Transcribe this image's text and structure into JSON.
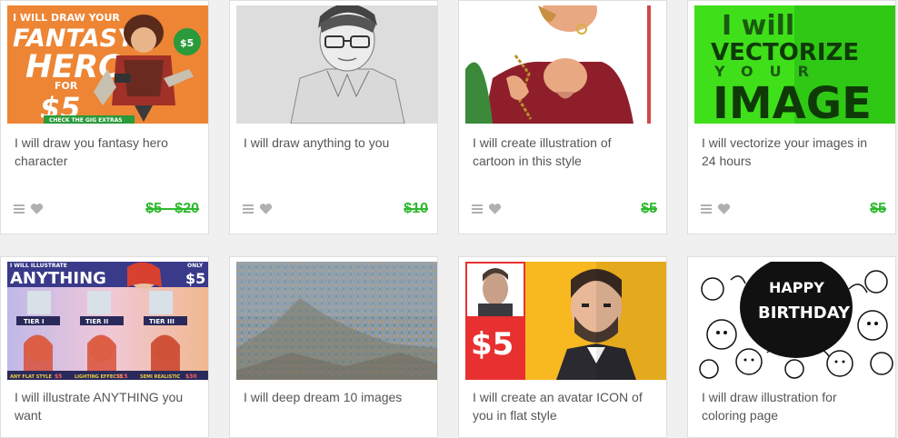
{
  "cards": [
    {
      "title": "I will draw you fantasy hero character",
      "price": "$5 - $20",
      "thumb": {
        "line1": "I WILL DRAW YOUR",
        "line2": "FANTASY",
        "line3": "HERO",
        "line4": "FOR",
        "line5": "$5",
        "badge": "$5",
        "foot": "CHECK THE GIG EXTRAS",
        "bg": "#f08a3a"
      }
    },
    {
      "title": "I will draw anything to you",
      "price": "$10"
    },
    {
      "title": "I will create illustration of cartoon in this style",
      "price": "$5"
    },
    {
      "title": "I will vectorize your images in 24 hours",
      "price": "$5",
      "thumb": {
        "line1": "I will",
        "line2": "VECTORIZE",
        "line3": "YOUR",
        "line4": "IMAGE",
        "bg": "#3fe01a"
      }
    },
    {
      "title": "I will illustrate ANYTHING you want",
      "thumb": {
        "top": "I WILL ILLUSTRATE",
        "big": "ANYTHING",
        "only": "ONLY",
        "price": "$5",
        "tier1": "TIER I",
        "tier2": "TIER II",
        "tier3": "TIER III",
        "c1": "ANY FLAT STYLE",
        "c2": "LIGHTING EFFECTS",
        "c3": "SEMI REALISTIC",
        "p1": "$5",
        "p2": "$15",
        "p3": "$30"
      }
    },
    {
      "title": "I will deep dream 10 images"
    },
    {
      "title": "I will create an avatar ICON of you in flat style",
      "thumb": {
        "price": "$5"
      }
    },
    {
      "title": "I will draw illustration for coloring page",
      "thumb": {
        "line1": "HAPPY",
        "line2": "BIRTHDAY"
      }
    }
  ],
  "colors": {
    "price_green": "#2eb82e",
    "card_border": "#dedede",
    "title_gray": "#555555",
    "icon_gray": "#b0b0b0"
  },
  "icons": {
    "menu": "list-menu-icon",
    "favorite": "heart-icon"
  }
}
